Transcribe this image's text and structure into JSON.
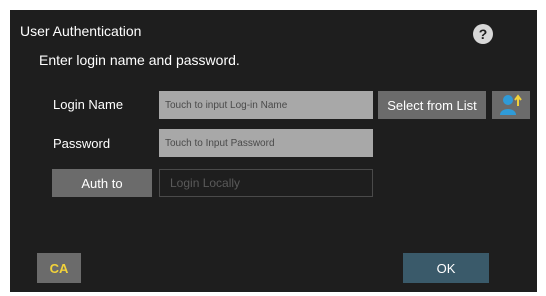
{
  "dialog": {
    "title": "User Authentication",
    "instruction": "Enter login name and password.",
    "help_icon": "question-mark-icon",
    "help_glyph": "?"
  },
  "form": {
    "login_label": "Login Name",
    "login_placeholder": "Touch to input Log-in Name",
    "password_label": "Password",
    "password_placeholder": "Touch to Input Password",
    "select_from_list_label": "Select from List",
    "user_list_icon": "user-upload-icon",
    "auth_to_label": "Auth to",
    "auth_to_value": "Login Locally"
  },
  "footer": {
    "ca_label": "CA",
    "ok_label": "OK"
  },
  "colors": {
    "dialog_bg": "#1e1e1e",
    "button_bg": "#6b6b6b",
    "field_bg": "#a8a8a8",
    "ok_bg": "#3a5a6a",
    "ca_text": "#f2d23a",
    "icon_blue": "#2f9bd8"
  }
}
